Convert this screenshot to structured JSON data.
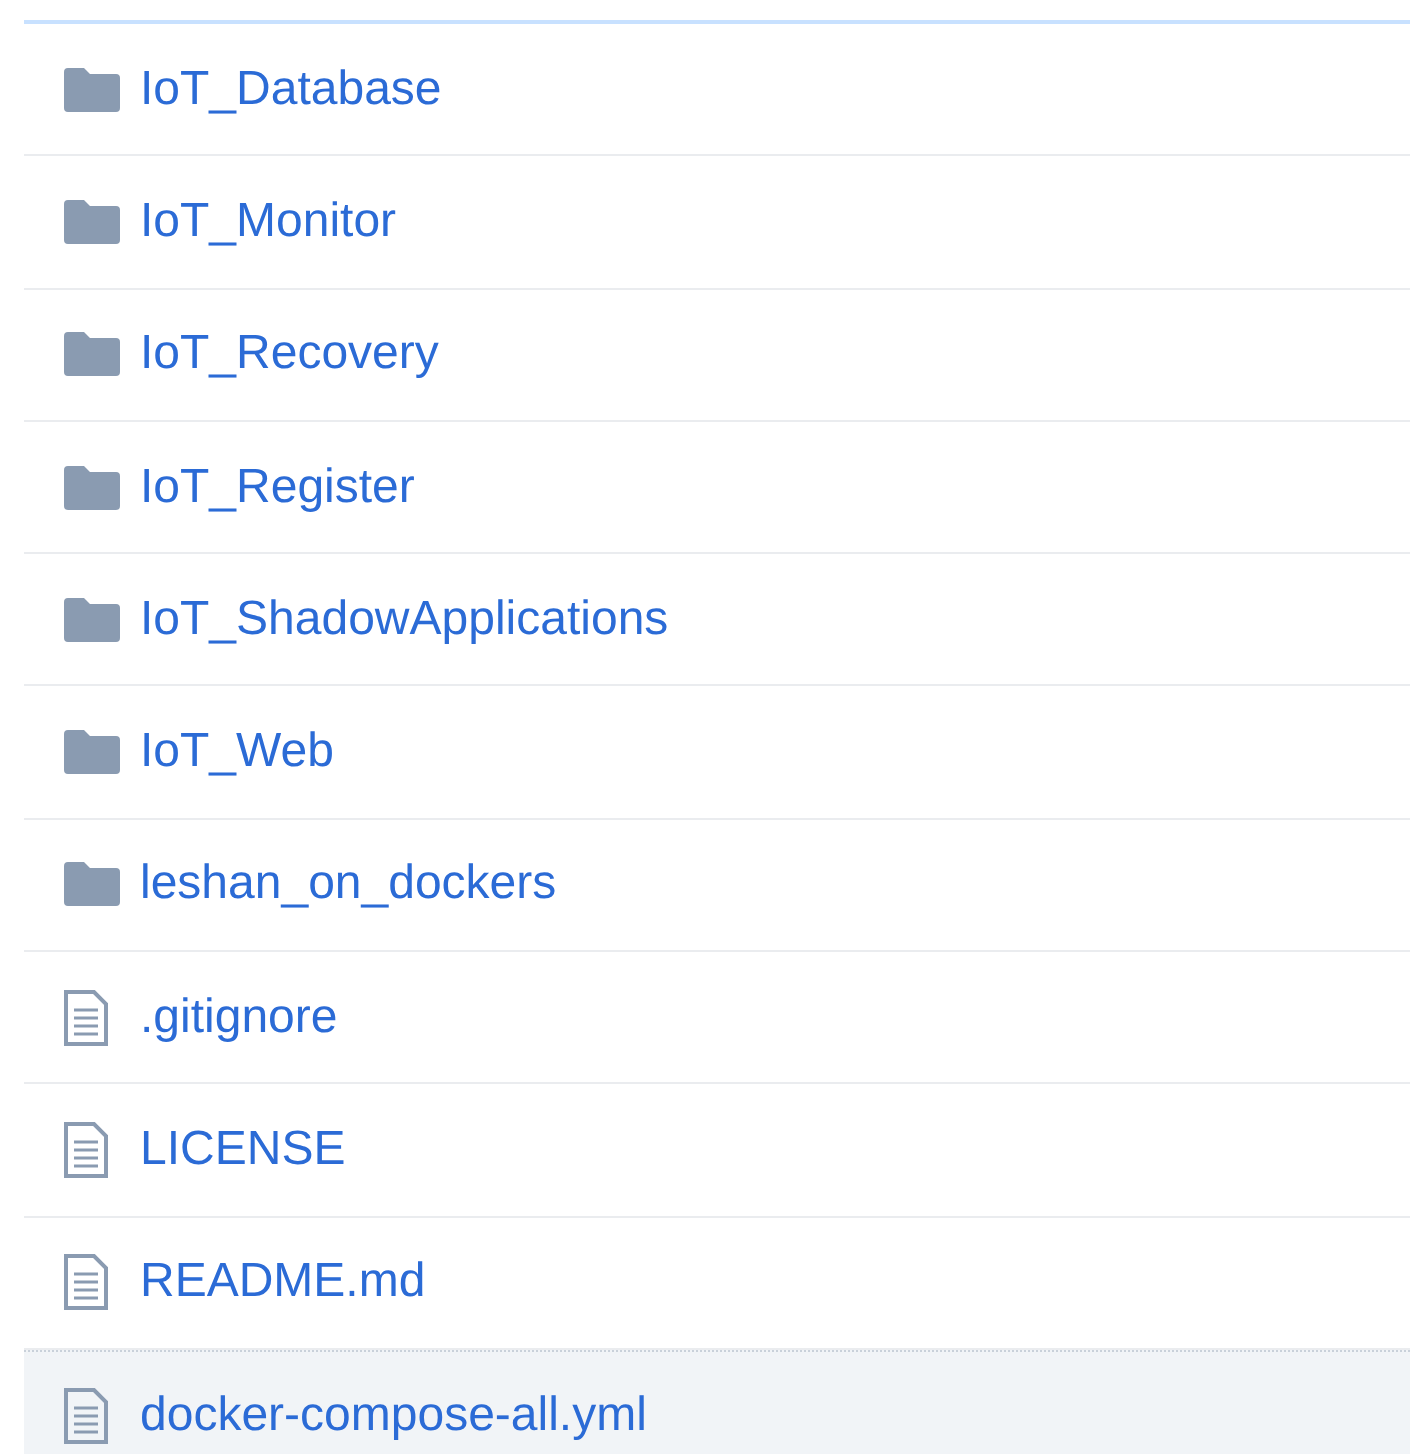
{
  "files": [
    {
      "kind": "folder",
      "name": "IoT_Database",
      "highlighted": false
    },
    {
      "kind": "folder",
      "name": "IoT_Monitor",
      "highlighted": false
    },
    {
      "kind": "folder",
      "name": "IoT_Recovery",
      "highlighted": false
    },
    {
      "kind": "folder",
      "name": "IoT_Register",
      "highlighted": false
    },
    {
      "kind": "folder",
      "name": "IoT_ShadowApplications",
      "highlighted": false
    },
    {
      "kind": "folder",
      "name": "IoT_Web",
      "highlighted": false
    },
    {
      "kind": "folder",
      "name": "leshan_on_dockers",
      "highlighted": false
    },
    {
      "kind": "file",
      "name": ".gitignore",
      "highlighted": false
    },
    {
      "kind": "file",
      "name": "LICENSE",
      "highlighted": false
    },
    {
      "kind": "file",
      "name": "README.md",
      "highlighted": false
    },
    {
      "kind": "file",
      "name": "docker-compose-all.yml",
      "highlighted": true
    }
  ]
}
